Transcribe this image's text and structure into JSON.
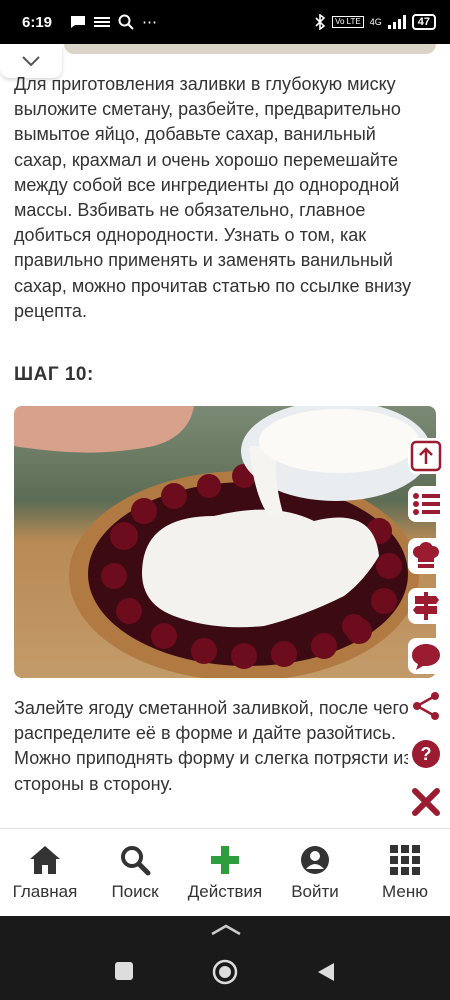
{
  "status_bar": {
    "time": "6:19",
    "network_label": "4G",
    "volte_label": "Vo LTE",
    "battery": "47"
  },
  "article": {
    "paragraph_1": "Для приготовления заливки в глубокую миску выложите сметану, разбейте, предварительно вымытое яйцо, добавьте сахар, ванильный сахар, крахмал и очень хорошо перемешайте между собой все ингредиенты до однородной массы. Взбивать не обязательно, главное добиться однородности. Узнать о том, как правильно применять и заменять ванильный сахар, можно прочитав статью по ссылке внизу рецепта.",
    "step_title": "ШАГ 10:",
    "paragraph_2": "Залейте ягоду сметанной заливкой, после чего распределите её в форме и дайте разойтись. Можно приподнять форму и слегка потрясти из стороны в сторону."
  },
  "side_toolbar": {
    "icons": [
      "arrow-up-icon",
      "list-icon",
      "chef-hat-icon",
      "signpost-icon",
      "comment-icon",
      "share-icon",
      "help-icon",
      "close-icon"
    ],
    "accent": "#9b1b30"
  },
  "bottom_nav": {
    "items": [
      {
        "label": "Главная",
        "icon": "home-icon"
      },
      {
        "label": "Поиск",
        "icon": "search-icon"
      },
      {
        "label": "Действия",
        "icon": "plus-icon"
      },
      {
        "label": "Войти",
        "icon": "user-icon"
      },
      {
        "label": "Меню",
        "icon": "grid-icon"
      }
    ],
    "accent_plus": "#2e9d3c"
  }
}
